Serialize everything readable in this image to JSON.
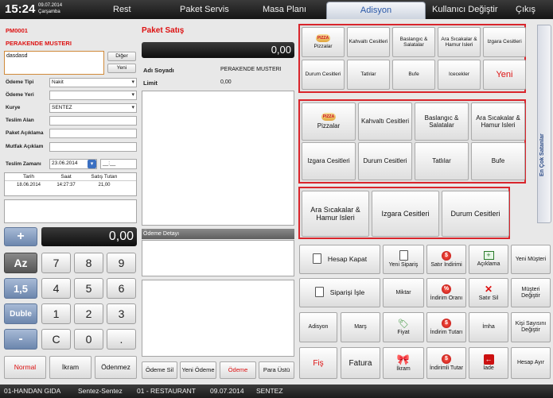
{
  "topbar": {
    "time": "15:24",
    "date": "09.07.2014",
    "day": "Çarşamba",
    "nav": [
      "Rest",
      "Paket Servis",
      "Masa Planı"
    ],
    "active_tab": "Adisyon",
    "user_change": "Kullanıcı Değiştir",
    "exit": "Çıkış"
  },
  "left": {
    "code": "PM0001",
    "customer": "PERAKENDE MUSTERI",
    "note": "dasdasd",
    "btn_diger": "Diğer",
    "btn_yeni": "Yeni",
    "fields": [
      {
        "label": "Ödeme Tipi",
        "value": "Nakit",
        "select": true
      },
      {
        "label": "Ödeme Yeri",
        "value": "",
        "select": true
      },
      {
        "label": "Kurye",
        "value": "SENTEZ",
        "select": true
      },
      {
        "label": "Teslim Alan",
        "value": "",
        "select": false
      },
      {
        "label": "Paket Açıklama",
        "value": "",
        "select": false
      },
      {
        "label": "Mutfak Açıklam",
        "value": "",
        "select": false
      }
    ],
    "delivery_label": "Teslim Zamanı",
    "delivery_date": "23.06.2014",
    "delivery_time": "__:__",
    "history_headers": [
      "Tarih",
      "Saat",
      "Satış Tutarı"
    ],
    "history_rows": [
      [
        "18.06.2014",
        "14:27:37",
        "21,00"
      ]
    ]
  },
  "keypad": {
    "display": "0,00",
    "plus": "+",
    "az": "Az",
    "minus": "-",
    "onebfive": "1,5",
    "duble": "Duble",
    "keys": [
      "7",
      "8",
      "9",
      "4",
      "5",
      "6",
      "1",
      "2",
      "3",
      "C",
      "0",
      "."
    ],
    "bottom": [
      "Normal",
      "İkram",
      "Ödenmez"
    ]
  },
  "middle": {
    "title": "Paket Satış",
    "amount": "0,00",
    "name_label": "Adı Soyadı",
    "name_value": "PERAKENDE MUSTERI",
    "limit_label": "Limit",
    "limit_value": "0,00",
    "payment_detail": "Ödeme Detayı",
    "buttons": [
      "Ödeme Sil",
      "Yeni Ödeme",
      "Ödeme",
      "Para Üstü"
    ]
  },
  "categories": {
    "group1": [
      "Pizzalar",
      "Kahvaltı Cesitleri",
      "Baslangıc & Salatalar",
      "Ara Sıcakalar & Hamur Isleri",
      "Izgara Cesitleri",
      "Durum Cesitleri",
      "Tatlılar",
      "Bufe",
      "Icecekler",
      "Yeni"
    ],
    "group2": [
      "Pizzalar",
      "Kahvaltı Cesitleri",
      "Baslangıc & Salatalar",
      "Ara Sıcakalar & Hamur Isleri",
      "Izgara Cesitleri",
      "Durum Cesitleri",
      "Tatlılar",
      "Bufe"
    ],
    "group3": [
      "Ara Sıcakalar & Hamur Isleri",
      "Izgara Cesitleri",
      "Durum Cesitleri"
    ],
    "pizza_logo": "PIZZA"
  },
  "sidebar_tab": "En Çok Satanlar",
  "actions": {
    "row1": [
      "Hesap Kapat",
      "Yeni Sipariş",
      "Satır İndirimi",
      "Açıklama",
      "Yeni Müşteri"
    ],
    "row2": [
      "Siparişi İşle",
      "Miktar",
      "İndirim Oranı",
      "Satır Sil",
      "Müşteri Değiştir"
    ],
    "row3": [
      "Adisyon",
      "Marş",
      "Fiyat",
      "İndirim Tutarı",
      "İmha",
      "Kişi Sayısını Değiştir"
    ],
    "row4": [
      "Fiş",
      "Fatura",
      "İkram",
      "İndirimli Tutar",
      "İade",
      "Hesap Ayır"
    ]
  },
  "status": [
    "01-HANDAN GIDA",
    "Sentez-Sentez",
    "01 - RESTAURANT",
    "09.07.2014",
    "SENTEZ"
  ]
}
